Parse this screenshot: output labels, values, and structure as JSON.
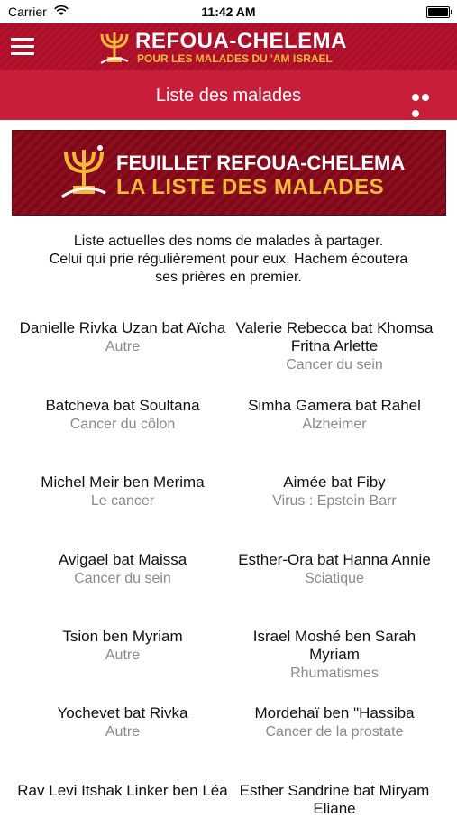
{
  "status_bar": {
    "carrier": "Carrier",
    "time": "11:42 AM"
  },
  "header": {
    "logo_title": "REFOUA-CHELEMA",
    "logo_subtitle": "POUR LES MALADES DU 'AM ISRAEL"
  },
  "subheader": {
    "title": "Liste des malades"
  },
  "banner": {
    "line1": "FEUILLET REFOUA-CHELEMA",
    "line2": "LA LISTE DES MALADES"
  },
  "intro": {
    "line1": "Liste actuelles des noms de malades à partager.",
    "line2": "Celui qui prie régulièrement pour eux, Hachem écoutera",
    "line3": "ses prières en premier."
  },
  "patients": [
    {
      "name": "Danielle Rivka Uzan bat Aïcha",
      "condition": "Autre"
    },
    {
      "name": "Valerie Rebecca bat Khomsa Fritna Arlette",
      "condition": "Cancer du sein"
    },
    {
      "name": "Batcheva bat Soultana",
      "condition": "Cancer du côlon"
    },
    {
      "name": "Simha Gamera bat Rahel",
      "condition": "Alzheimer"
    },
    {
      "name": "Michel Meir ben Merima",
      "condition": "Le cancer"
    },
    {
      "name": "Aimée bat Fiby",
      "condition": "Virus : Epstein Barr"
    },
    {
      "name": "Avigael bat Maissa",
      "condition": "Cancer du sein"
    },
    {
      "name": "Esther-Ora bat Hanna Annie",
      "condition": "Sciatique"
    },
    {
      "name": "Tsion ben Myriam",
      "condition": "Autre"
    },
    {
      "name": "Israel Moshé ben Sarah Myriam",
      "condition": "Rhumatismes"
    },
    {
      "name": "Yochevet bat Rivka",
      "condition": "Autre"
    },
    {
      "name": "Mordehaï ben \"Hassiba",
      "condition": "Cancer de la prostate"
    },
    {
      "name": "Rav Levi Itshak Linker ben Léa",
      "condition": ""
    },
    {
      "name": "Esther Sandrine bat Miryam Eliane",
      "condition": ""
    }
  ],
  "colors": {
    "header_bg": "#b5122e",
    "subheader_bg": "#c81e3a",
    "gold": "#f2b83a",
    "condition_text": "#8a8a8a"
  },
  "icons": [
    "wifi-icon",
    "battery-icon",
    "hamburger-menu-icon",
    "menorah-logo-icon",
    "more-options-icon"
  ]
}
